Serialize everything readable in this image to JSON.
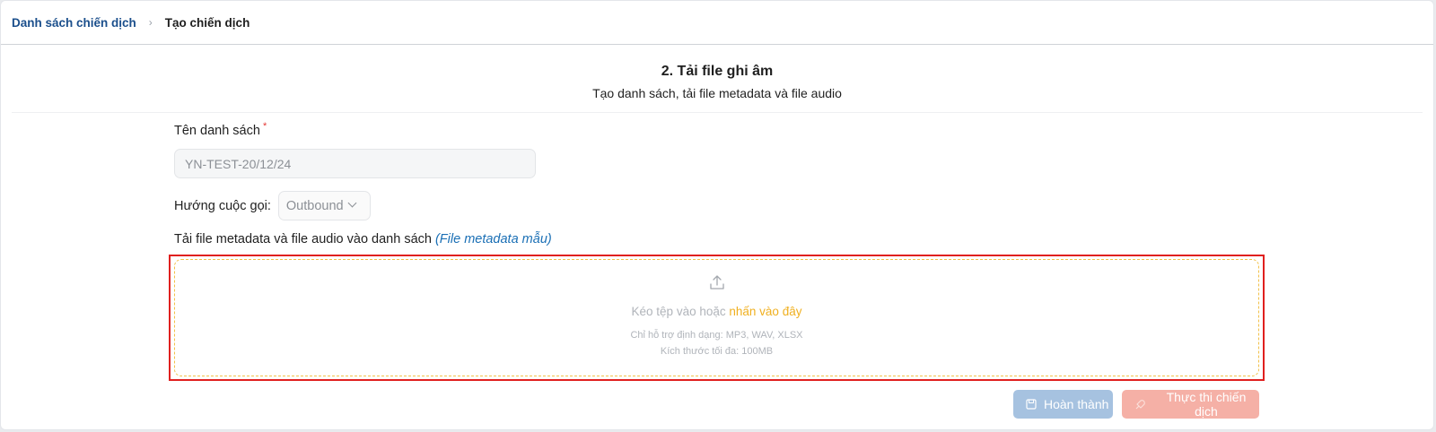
{
  "breadcrumb": {
    "parent": "Danh sách chiến dịch",
    "separator": "›",
    "current": "Tạo chiến dịch"
  },
  "step": {
    "title": "2. Tải file ghi âm",
    "subtitle": "Tạo danh sách, tải file metadata và file audio"
  },
  "form": {
    "name_label": "Tên danh sách",
    "required_mark": "*",
    "name_value": "YN-TEST-20/12/24",
    "direction_label": "Hướng cuộc gọi:",
    "direction_value": "Outbound",
    "upload_label": "Tải file metadata và file audio vào danh sách",
    "sample_link": "(File metadata mẫu)"
  },
  "dropzone": {
    "icon": "upload-icon",
    "text": "Kéo tệp vào hoặc",
    "link": "nhấn vào đây",
    "formats": "Chỉ hỗ trợ định dạng: MP3, WAV, XLSX",
    "max_size": "Kích thước tối đa: 100MB"
  },
  "actions": {
    "done": "Hoàn thành",
    "run": "Thực thi chiến dịch"
  },
  "colors": {
    "primary_link": "#1b4f8c",
    "highlight": "#e0201f",
    "dropzone_border": "#f2c14a",
    "done_button": "#a6c2e0",
    "run_button": "#f5b0a6"
  }
}
